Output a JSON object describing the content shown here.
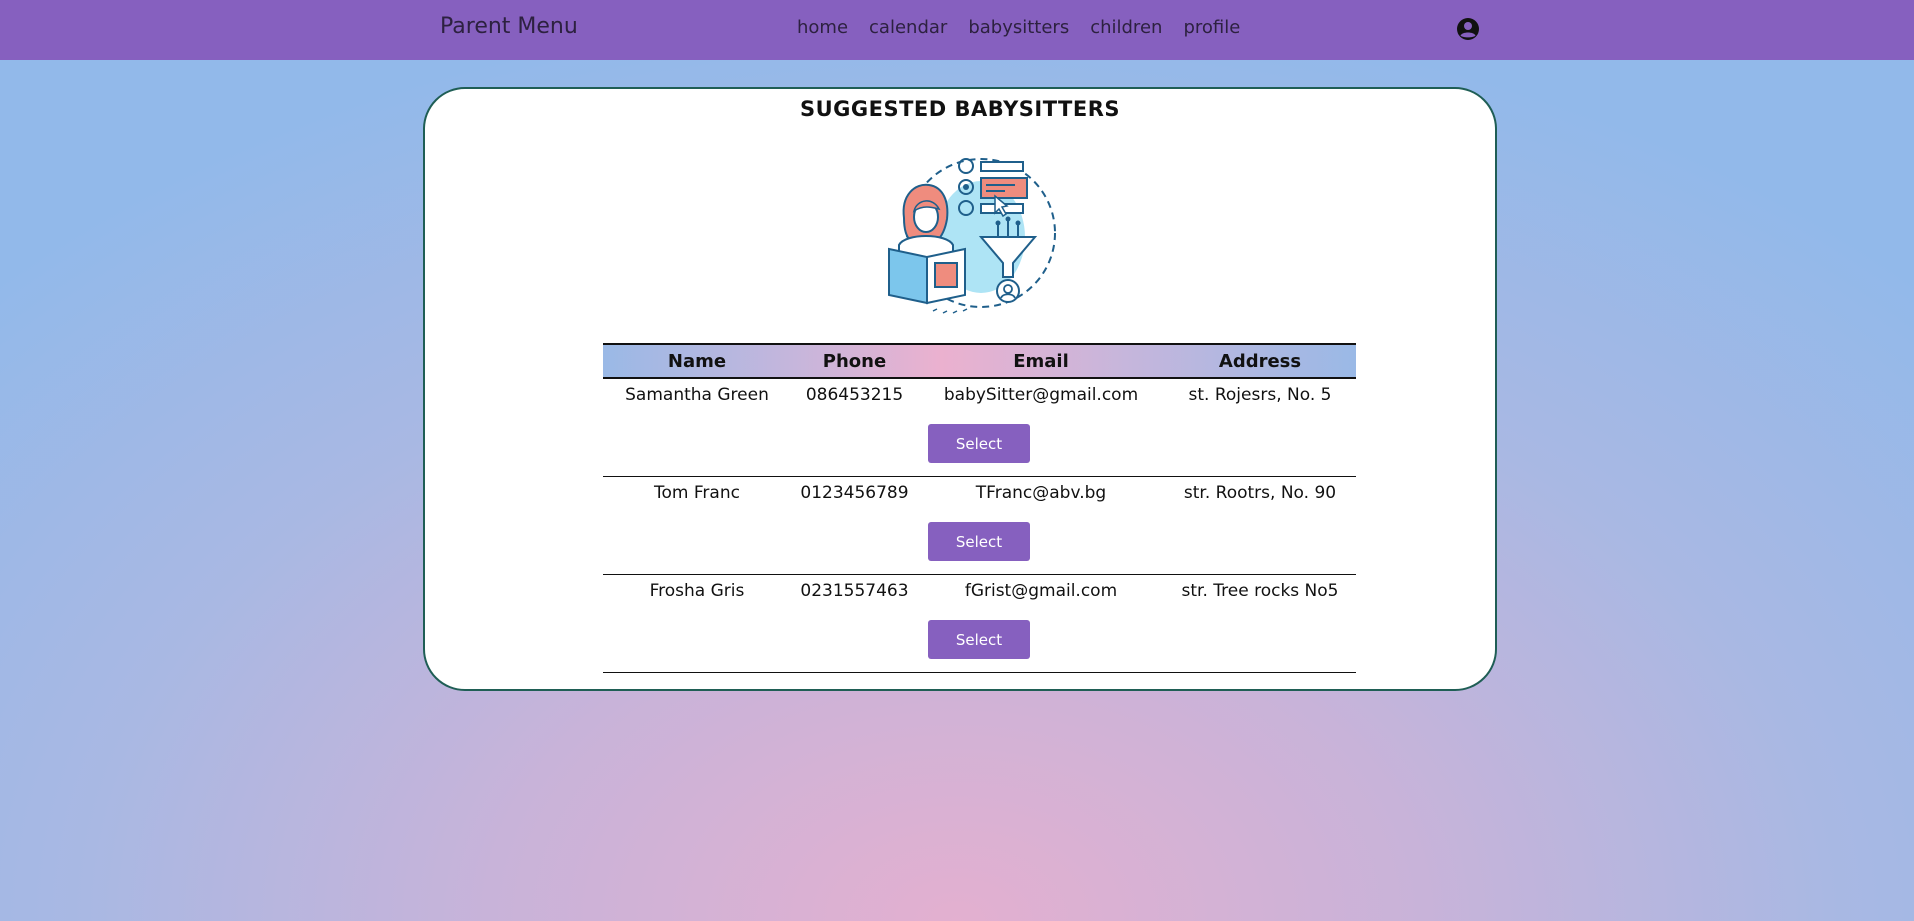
{
  "nav": {
    "brand": "Parent Menu",
    "links": [
      "home",
      "calendar",
      "babysitters",
      "children",
      "profile"
    ],
    "accent_color": "#8660bf",
    "profile_icon": "user-circle-icon"
  },
  "main": {
    "title": "SUGGESTED BABYSITTERS",
    "illustration_icon": "person-reading-filter-illustration",
    "table": {
      "headers": [
        "Name",
        "Phone",
        "Email",
        "Address"
      ],
      "rows": [
        {
          "name": "Samantha Green",
          "phone": "086453215",
          "email": "babySitter@gmail.com",
          "address": "st. Rojesrs, No. 5",
          "button": "Select"
        },
        {
          "name": "Tom Franc",
          "phone": "0123456789",
          "email": "TFranc@abv.bg",
          "address": "str. Rootrs, No. 90",
          "button": "Select"
        },
        {
          "name": "Frosha Gris",
          "phone": "0231557463",
          "email": "fGrist@gmail.com",
          "address": "str. Tree rocks No5",
          "button": "Select"
        }
      ]
    }
  }
}
